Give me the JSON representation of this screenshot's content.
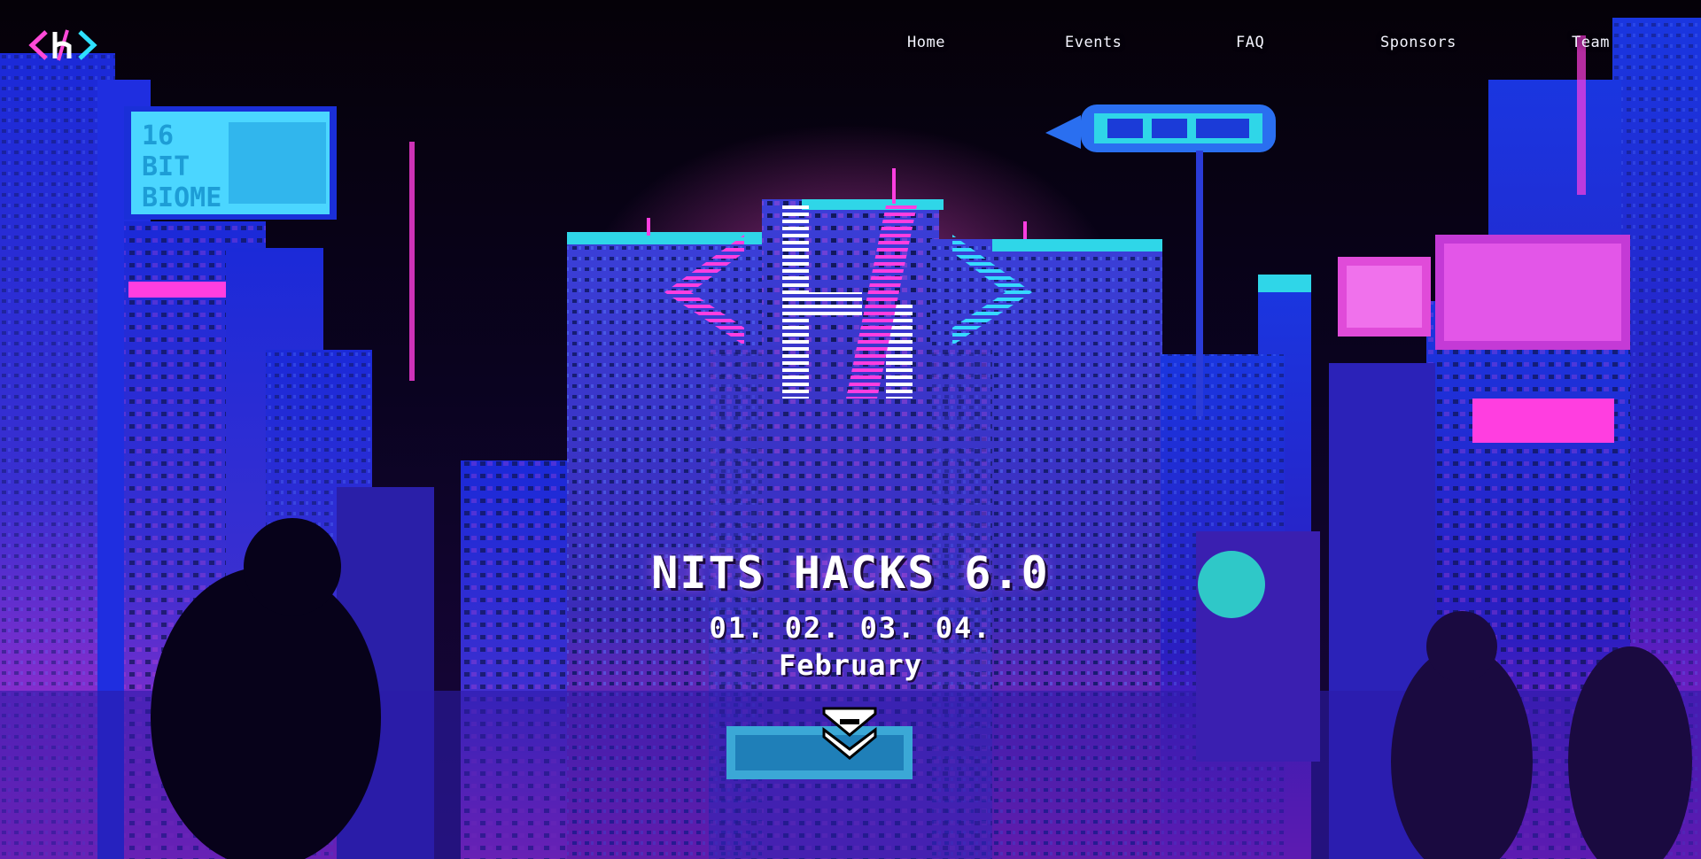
{
  "nav": {
    "items": [
      {
        "label": "Home"
      },
      {
        "label": "Events"
      },
      {
        "label": "FAQ"
      },
      {
        "label": "Sponsors"
      },
      {
        "label": "Team"
      }
    ]
  },
  "hero": {
    "title": "NITS HACKS 6.0",
    "dates": "01. 02. 03. 04.",
    "month": "February"
  },
  "billboard": {
    "line1": "16",
    "line2": "BIT",
    "line3": "BIOME"
  },
  "colors": {
    "magenta": "#ff2bd6",
    "cyan": "#2de2ff",
    "blue": "#2a2cff",
    "deep_purple": "#2a0a6a",
    "background": "#07020f"
  },
  "icons": {
    "brand_logo": "code-slash-logo",
    "scroll": "double-chevron-down-icon"
  }
}
